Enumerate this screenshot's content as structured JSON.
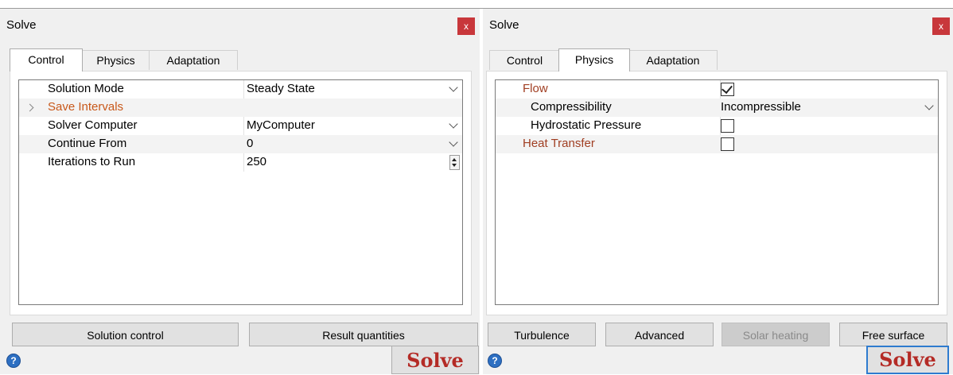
{
  "left": {
    "title": "Solve",
    "close_label": "x",
    "tabs": [
      "Control",
      "Physics",
      "Adaptation"
    ],
    "active_tab": "Control",
    "rows": [
      {
        "label": "Solution Mode",
        "value": "Steady State",
        "control": "dropdown"
      },
      {
        "label": "Save Intervals",
        "value": "",
        "control": "expander",
        "color": "#c8581a"
      },
      {
        "label": "Solver Computer",
        "value": "MyComputer",
        "control": "dropdown"
      },
      {
        "label": "Continue From",
        "value": "0",
        "control": "dropdown"
      },
      {
        "label": "Iterations to Run",
        "value": "250",
        "control": "spinner"
      }
    ],
    "buttons": [
      "Solution control",
      "Result quantities"
    ],
    "help_label": "?",
    "solve_label": "Solve"
  },
  "right": {
    "title": "Solve",
    "close_label": "x",
    "tabs": [
      "Control",
      "Physics",
      "Adaptation"
    ],
    "active_tab": "Physics",
    "rows": [
      {
        "label": "Flow",
        "control": "checkbox",
        "checked": true,
        "color": "#a03e22"
      },
      {
        "label": "Compressibility",
        "value": "Incompressible",
        "control": "dropdown"
      },
      {
        "label": "Hydrostatic Pressure",
        "control": "checkbox",
        "checked": false
      },
      {
        "label": "Heat Transfer",
        "control": "checkbox",
        "checked": false,
        "color": "#a03e22"
      }
    ],
    "buttons": [
      {
        "label": "Turbulence",
        "enabled": true
      },
      {
        "label": "Advanced",
        "enabled": true
      },
      {
        "label": "Solar heating",
        "enabled": false
      },
      {
        "label": "Free surface",
        "enabled": true
      }
    ],
    "help_label": "?",
    "solve_label": "Solve"
  },
  "colors": {
    "close_button": "#c8373b",
    "solve_text": "#b42b26",
    "highlight_label": "#c8581a",
    "focus_border": "#2e7bcf"
  }
}
